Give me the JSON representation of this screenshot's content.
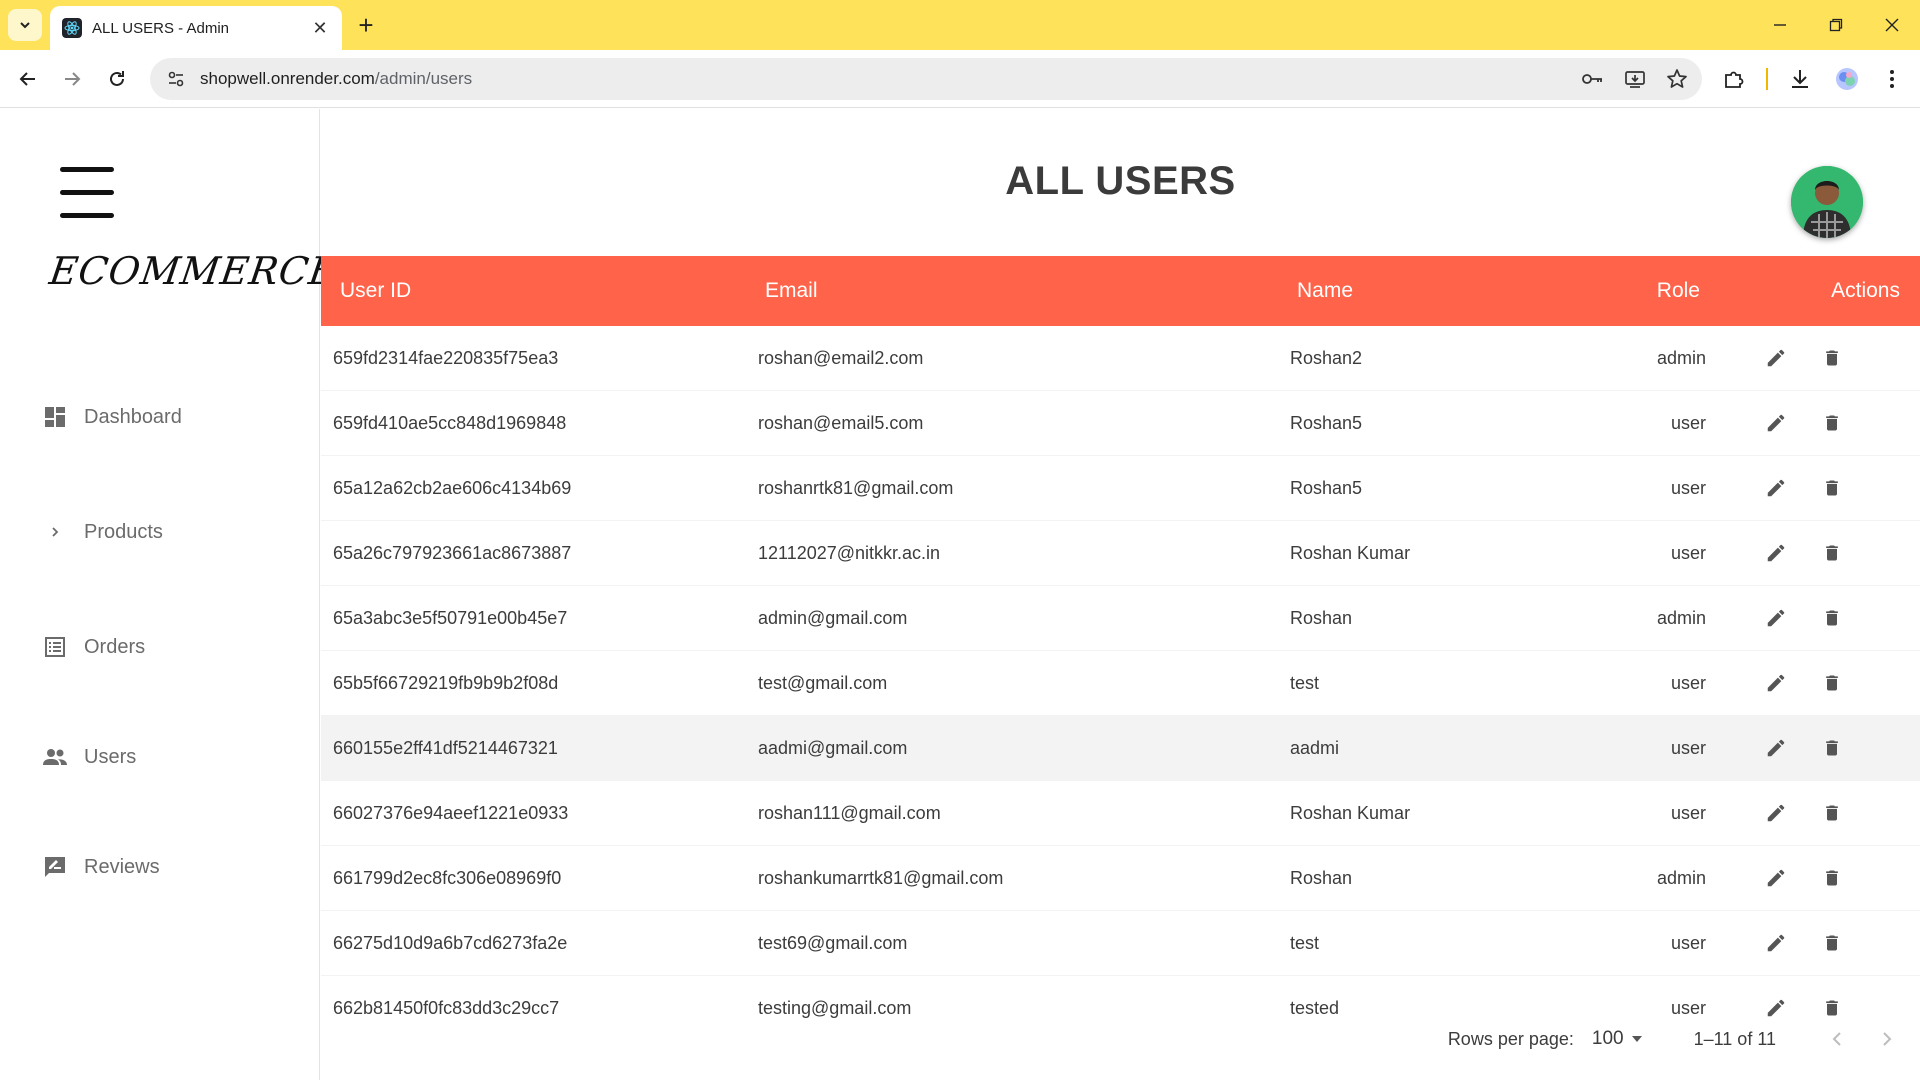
{
  "browser": {
    "tab_title": "ALL USERS - Admin",
    "url_host": "shopwell.onrender.com",
    "url_path": "/admin/users"
  },
  "sidebar": {
    "brand": "ECOMMERCE.",
    "items": [
      {
        "label": "Dashboard",
        "icon": "dashboard-icon"
      },
      {
        "label": "Products",
        "icon": "chevron-right-icon"
      },
      {
        "label": "Orders",
        "icon": "list-alt-icon"
      },
      {
        "label": "Users",
        "icon": "people-icon"
      },
      {
        "label": "Reviews",
        "icon": "rate-review-icon"
      }
    ]
  },
  "page": {
    "title": "ALL USERS"
  },
  "table": {
    "columns": [
      "User ID",
      "Email",
      "Name",
      "Role",
      "Actions"
    ],
    "rows": [
      {
        "id": "659fd2314fae220835f75ea3",
        "email": "roshan@email2.com",
        "name": "Roshan2",
        "role": "admin"
      },
      {
        "id": "659fd410ae5cc848d1969848",
        "email": "roshan@email5.com",
        "name": "Roshan5",
        "role": "user"
      },
      {
        "id": "65a12a62cb2ae606c4134b69",
        "email": "roshanrtk81@gmail.com",
        "name": "Roshan5",
        "role": "user"
      },
      {
        "id": "65a26c797923661ac8673887",
        "email": "12112027@nitkkr.ac.in",
        "name": "Roshan Kumar",
        "role": "user"
      },
      {
        "id": "65a3abc3e5f50791e00b45e7",
        "email": "admin@gmail.com",
        "name": "Roshan",
        "role": "admin"
      },
      {
        "id": "65b5f66729219fb9b9b2f08d",
        "email": "test@gmail.com",
        "name": "test",
        "role": "user"
      },
      {
        "id": "660155e2ff41df5214467321",
        "email": "aadmi@gmail.com",
        "name": "aadmi",
        "role": "user"
      },
      {
        "id": "66027376e94aeef1221e0933",
        "email": "roshan111@gmail.com",
        "name": "Roshan Kumar",
        "role": "user"
      },
      {
        "id": "661799d2ec8fc306e08969f0",
        "email": "roshankumarrtk81@gmail.com",
        "name": "Roshan",
        "role": "admin"
      },
      {
        "id": "66275d10d9a6b7cd6273fa2e",
        "email": "test69@gmail.com",
        "name": "test",
        "role": "user"
      },
      {
        "id": "662b81450f0fc83dd3c29cc7",
        "email": "testing@gmail.com",
        "name": "tested",
        "role": "user"
      }
    ],
    "hover_row_index": 6
  },
  "pagination": {
    "rows_per_page_label": "Rows per page:",
    "rows_per_page_value": "100",
    "range_text": "1–11 of 11"
  },
  "colors": {
    "header_bg": "#ff634a",
    "chrome_bg": "#fde25a"
  }
}
